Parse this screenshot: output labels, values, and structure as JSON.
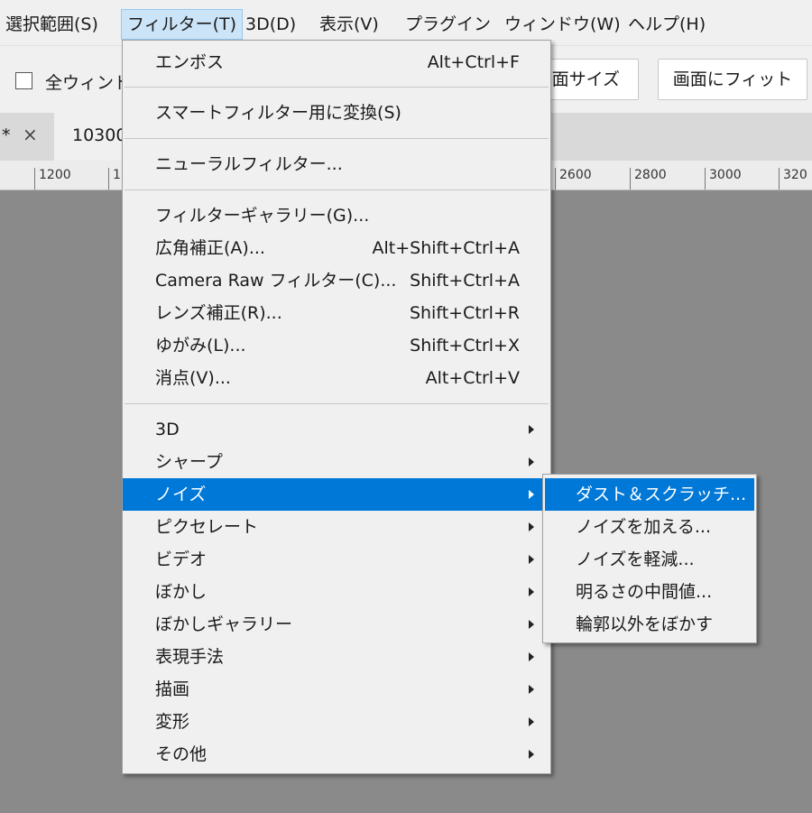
{
  "menubar": {
    "items": [
      {
        "label": "選択範囲(S)"
      },
      {
        "label": "フィルター(T)"
      },
      {
        "label": "3D(D)"
      },
      {
        "label": "表示(V)"
      },
      {
        "label": "プラグイン"
      },
      {
        "label": "ウィンドウ(W)"
      },
      {
        "label": "ヘルプ(H)"
      }
    ]
  },
  "options_bar": {
    "all_windows_label": "全ウィンド",
    "screen_size_label": "画面サイズ",
    "fit_screen_label": "画面にフィット"
  },
  "tabs": {
    "prev_tab_marker": "*",
    "close_glyph": "×",
    "active_title": "10300"
  },
  "ruler": {
    "labels": [
      "1200",
      "1",
      "2600",
      "2800",
      "3000",
      "320"
    ]
  },
  "filter_menu": {
    "emboss": {
      "label": "エンボス",
      "shortcut": "Alt+Ctrl+F"
    },
    "smart_filter": {
      "label": "スマートフィルター用に変換(S)"
    },
    "neural": {
      "label": "ニューラルフィルター..."
    },
    "gallery": {
      "label": "フィルターギャラリー(G)..."
    },
    "wide_angle": {
      "label": "広角補正(A)...",
      "shortcut": "Alt+Shift+Ctrl+A"
    },
    "camera_raw": {
      "label": "Camera Raw フィルター(C)...",
      "shortcut": "Shift+Ctrl+A"
    },
    "lens": {
      "label": "レンズ補正(R)...",
      "shortcut": "Shift+Ctrl+R"
    },
    "liquify": {
      "label": "ゆがみ(L)...",
      "shortcut": "Shift+Ctrl+X"
    },
    "vanishing": {
      "label": "消点(V)...",
      "shortcut": "Alt+Ctrl+V"
    },
    "groups": [
      {
        "label": "3D"
      },
      {
        "label": "シャープ"
      },
      {
        "label": "ノイズ"
      },
      {
        "label": "ピクセレート"
      },
      {
        "label": "ビデオ"
      },
      {
        "label": "ぼかし"
      },
      {
        "label": "ぼかしギャラリー"
      },
      {
        "label": "表現手法"
      },
      {
        "label": "描画"
      },
      {
        "label": "変形"
      },
      {
        "label": "その他"
      }
    ]
  },
  "noise_submenu": {
    "items": [
      {
        "label": "ダスト＆スクラッチ..."
      },
      {
        "label": "ノイズを加える..."
      },
      {
        "label": "ノイズを軽減..."
      },
      {
        "label": "明るさの中間値..."
      },
      {
        "label": "輪郭以外をぼかす"
      }
    ]
  },
  "colors": {
    "highlight": "#0078d7",
    "menu_background": "#f0f0f0",
    "canvas_background": "#8a8a8a"
  }
}
